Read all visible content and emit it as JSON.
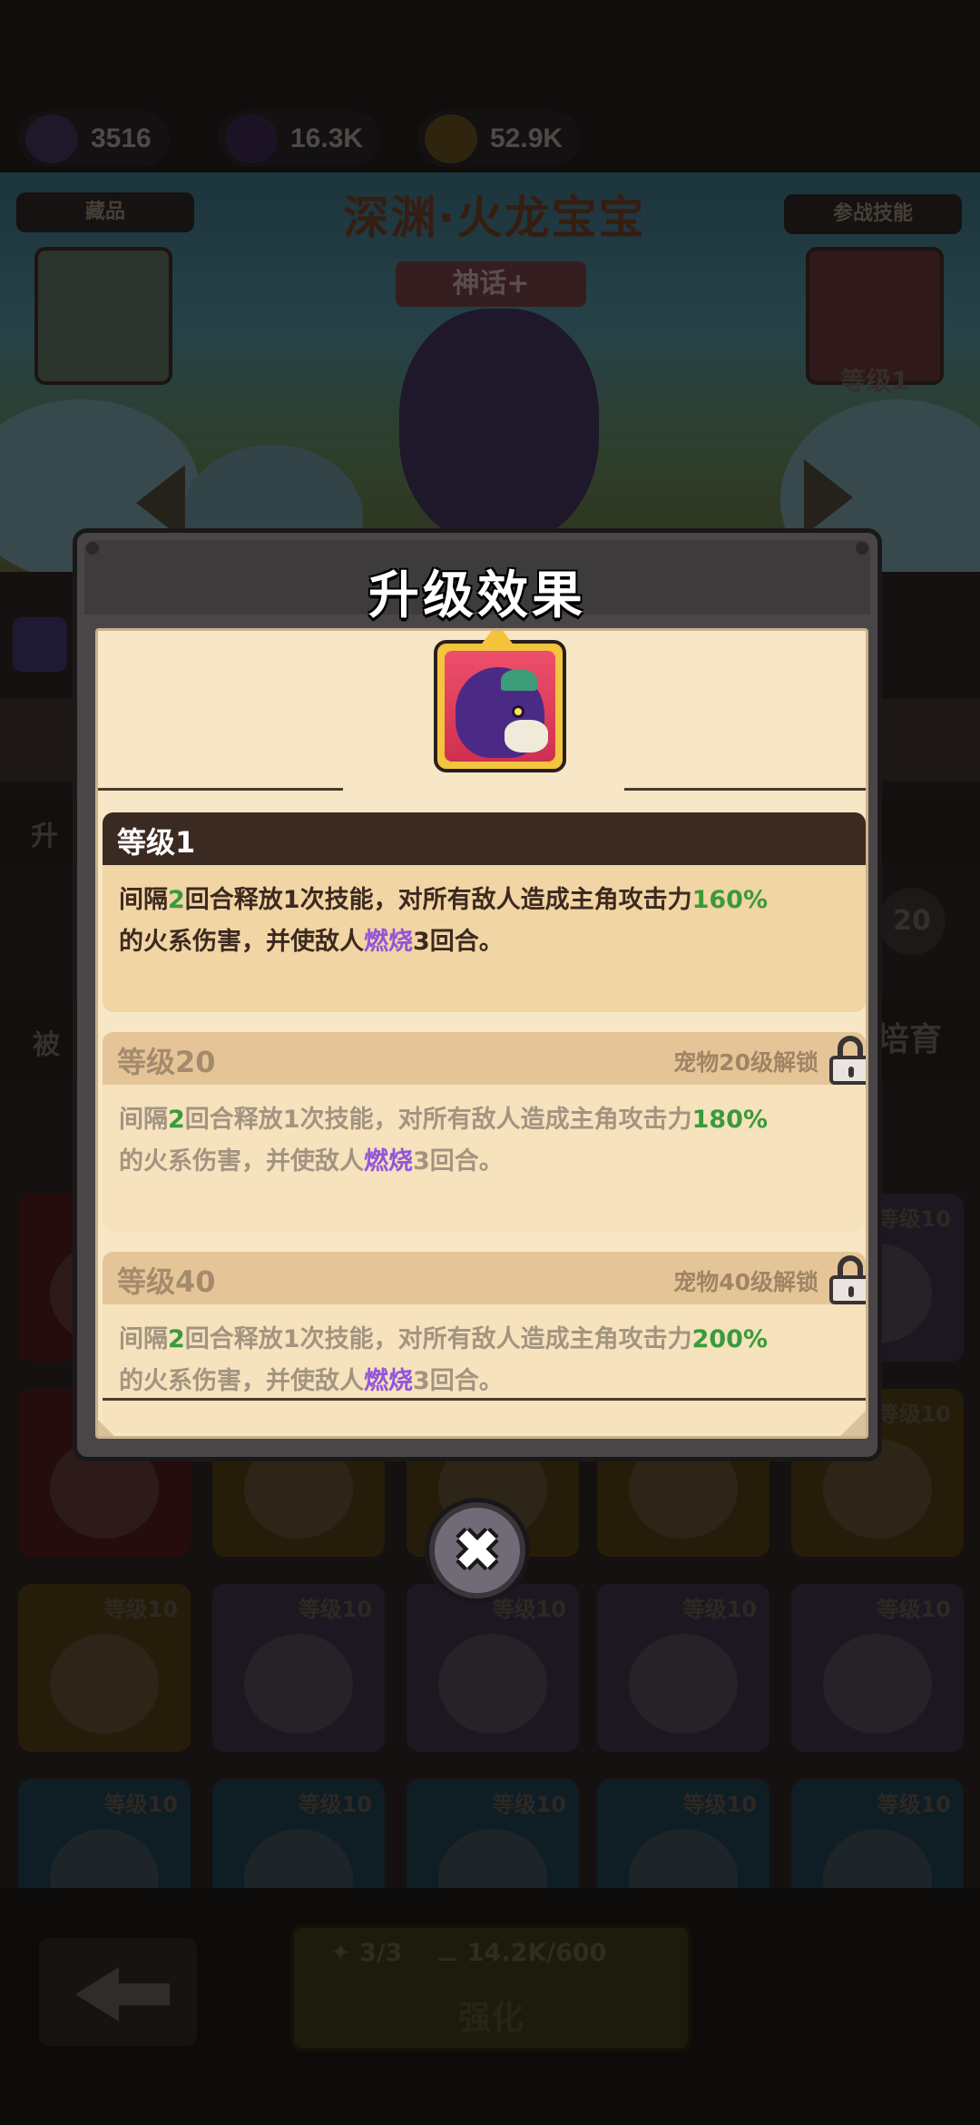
{
  "resources": [
    {
      "name": "egg",
      "value": "3516",
      "color": "#5a3c8a"
    },
    {
      "name": "cube",
      "value": "16.3K",
      "color": "#4a2e6a"
    },
    {
      "name": "coin",
      "value": "52.9K",
      "color": "#a07f2a"
    }
  ],
  "background": {
    "pet_name": "深渊·火龙宝宝",
    "rarity": "神话+",
    "collection_label": "藏品",
    "battle_skill_label": "参战技能",
    "battle_skill_level": "等级1",
    "upgrade_tab": "升",
    "passive_tab": "被",
    "cultivate_tab": "培育",
    "side_level": "20",
    "pet_levels": [
      "等级10",
      "等级10",
      "等级10",
      "等级10",
      "等级10",
      "等级10",
      "等级10",
      "等级10",
      "等级10",
      "等级10",
      "等级10",
      "等级10"
    ],
    "enhance": {
      "shards": "3/3",
      "bones": "14.2K/600",
      "label": "强化"
    }
  },
  "modal": {
    "title": "升级效果",
    "levels": [
      {
        "level": "等级1",
        "locked": false,
        "unlock_text": "",
        "desc_prefix": "间隔",
        "turns": "2",
        "desc_mid": "回合释放1次技能，对所有敌人造成主角攻击力",
        "percent": "160%",
        "desc_mid2": "的火系伤害，并使敌人",
        "status": "燃烧",
        "desc_suffix": "3回合。"
      },
      {
        "level": "等级20",
        "locked": true,
        "unlock_text": "宠物20级解锁",
        "desc_prefix": "间隔",
        "turns": "2",
        "desc_mid": "回合释放1次技能，对所有敌人造成主角攻击力",
        "percent": "180%",
        "desc_mid2": "的火系伤害，并使敌人",
        "status": "燃烧",
        "desc_suffix": "3回合。"
      },
      {
        "level": "等级40",
        "locked": true,
        "unlock_text": "宠物40级解锁",
        "desc_prefix": "间隔",
        "turns": "2",
        "desc_mid": "回合释放1次技能，对所有敌人造成主角攻击力",
        "percent": "200%",
        "desc_mid2": "的火系伤害，并使敌人",
        "status": "燃烧",
        "desc_suffix": "3回合。"
      }
    ],
    "close_icon": "close-icon",
    "colors": {
      "highlight_green": "#3a9a3c",
      "highlight_purple": "#9356d9",
      "header_dark": "#3b2a22",
      "parchment": "#f7e7c6"
    }
  }
}
